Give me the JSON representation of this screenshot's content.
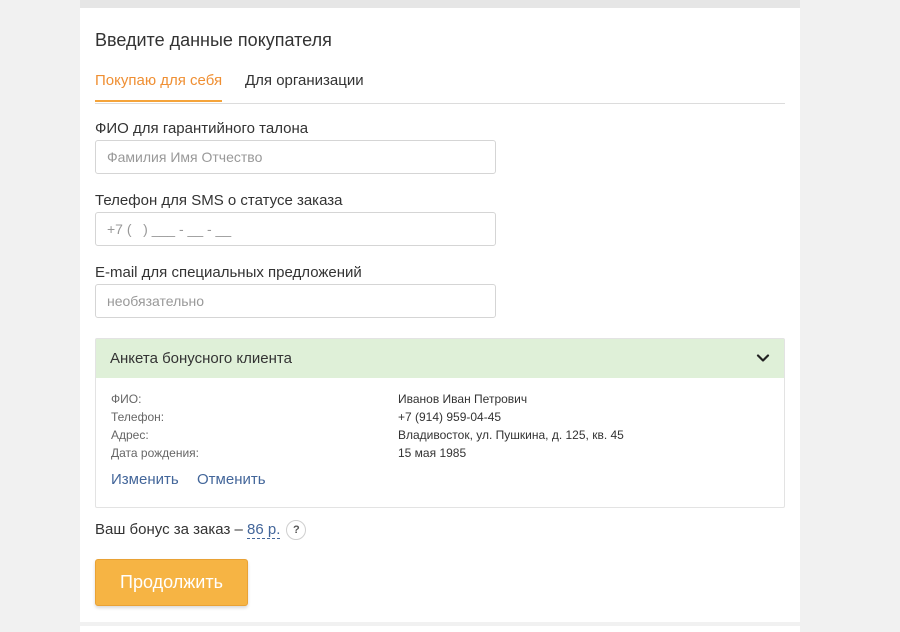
{
  "page": {
    "title": "Введите данные покупателя"
  },
  "tabs": [
    {
      "label": "Покупаю для себя",
      "active": true
    },
    {
      "label": "Для организации",
      "active": false
    }
  ],
  "form": {
    "fio": {
      "label": "ФИО для гарантийного талона",
      "placeholder": "Фамилия Имя Отчество",
      "value": ""
    },
    "phone": {
      "label": "Телефон для SMS о статусе заказа",
      "placeholder": "+7 (   ) ___ - __ - __",
      "value": ""
    },
    "email": {
      "label": "E-mail для специальных предложений",
      "placeholder": "необязательно",
      "value": ""
    }
  },
  "bonus_card": {
    "header": "Анкета бонусного клиента",
    "expanded": true,
    "fields": [
      {
        "label": "ФИО:",
        "value": "Иванов Иван Петрович"
      },
      {
        "label": "Телефон:",
        "value": "+7 (914) 959-04-45"
      },
      {
        "label": "Адрес:",
        "value": "Владивосток, ул. Пушкина, д. 125, кв. 45"
      },
      {
        "label": "Дата рождения:",
        "value": "15 мая 1985"
      }
    ],
    "edit_label": "Изменить",
    "cancel_label": "Отменить"
  },
  "bonus": {
    "text": "Ваш бонус за заказ – ",
    "amount": "86 р.",
    "help": "?"
  },
  "continue_label": "Продолжить",
  "colors": {
    "accent": "#f5a43b",
    "active_tab_text": "#ef8f33",
    "link": "#43669a",
    "bonus_header_bg": "#dff0d8",
    "button_bg": "#f6b444"
  }
}
